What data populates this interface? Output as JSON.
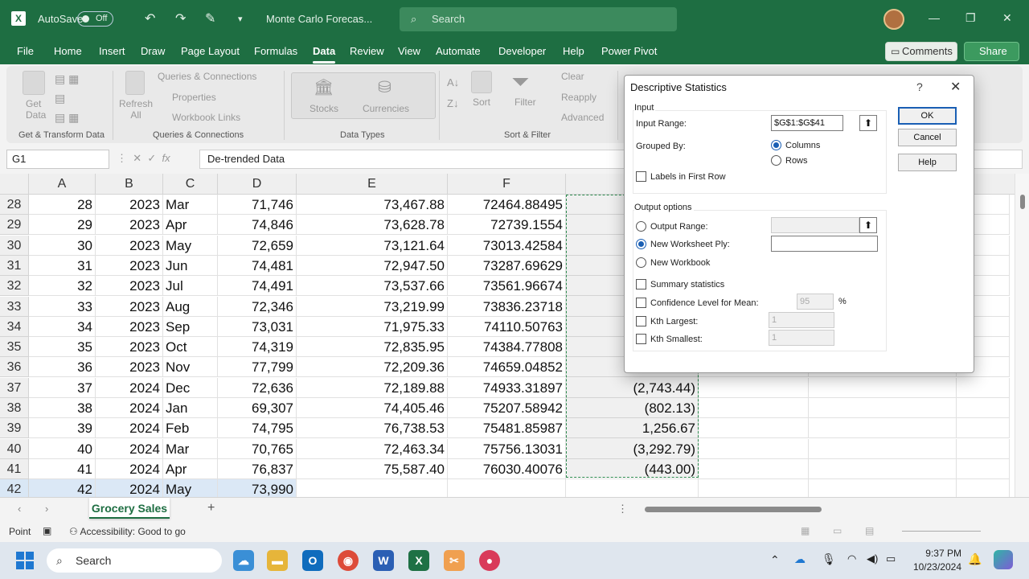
{
  "app": {
    "logo_letter": "X",
    "autosave_label": "AutoSave",
    "autosave_state": "Off",
    "doc_title": "Monte Carlo Forecas...",
    "search_placeholder": "Search"
  },
  "menu": {
    "tabs": [
      "File",
      "Home",
      "Insert",
      "Draw",
      "Page Layout",
      "Formulas",
      "Data",
      "Review",
      "View",
      "Automate",
      "Developer",
      "Help",
      "Power Pivot"
    ],
    "active_tab": "Data",
    "comments_label": "Comments",
    "share_label": "Share"
  },
  "ribbon": {
    "get_data": "Get\nData",
    "refresh_all": "Refresh\nAll",
    "queries_connections": "Queries & Connections",
    "properties": "Properties",
    "workbook_links": "Workbook Links",
    "stocks": "Stocks",
    "currencies": "Currencies",
    "sort": "Sort",
    "filter": "Filter",
    "clear": "Clear",
    "reapply": "Reapply",
    "advanced": "Advanced",
    "groups": {
      "get_transform": "Get & Transform Data",
      "queries": "Queries & Connections",
      "data_types": "Data Types",
      "sort_filter": "Sort & Filter"
    }
  },
  "formula_bar": {
    "name_box": "G1",
    "content": "De-trended Data"
  },
  "grid": {
    "columns": [
      "A",
      "B",
      "C",
      "D",
      "E",
      "F"
    ],
    "rows": [
      {
        "n": "28",
        "a": "28",
        "b": "2023",
        "c": "Mar",
        "d": "71,746",
        "e": "73,467.88",
        "f": "72464.88495",
        "g": ""
      },
      {
        "n": "29",
        "a": "29",
        "b": "2023",
        "c": "Apr",
        "d": "74,846",
        "e": "73,628.78",
        "f": "72739.1554",
        "g": ""
      },
      {
        "n": "30",
        "a": "30",
        "b": "2023",
        "c": "May",
        "d": "72,659",
        "e": "73,121.64",
        "f": "73013.42584",
        "g": ""
      },
      {
        "n": "31",
        "a": "31",
        "b": "2023",
        "c": "Jun",
        "d": "74,481",
        "e": "72,947.50",
        "f": "73287.69629",
        "g": ""
      },
      {
        "n": "32",
        "a": "32",
        "b": "2023",
        "c": "Jul",
        "d": "74,491",
        "e": "73,537.66",
        "f": "73561.96674",
        "g": ""
      },
      {
        "n": "33",
        "a": "33",
        "b": "2023",
        "c": "Aug",
        "d": "72,346",
        "e": "73,219.99",
        "f": "73836.23718",
        "g": ""
      },
      {
        "n": "34",
        "a": "34",
        "b": "2023",
        "c": "Sep",
        "d": "73,031",
        "e": "71,975.33",
        "f": "74110.50763",
        "g": ""
      },
      {
        "n": "35",
        "a": "35",
        "b": "2023",
        "c": "Oct",
        "d": "74,319",
        "e": "72,835.95",
        "f": "74384.77808",
        "g": ""
      },
      {
        "n": "36",
        "a": "36",
        "b": "2023",
        "c": "Nov",
        "d": "77,799",
        "e": "72,209.36",
        "f": "74659.04852",
        "g": ""
      },
      {
        "n": "37",
        "a": "37",
        "b": "2024",
        "c": "Dec",
        "d": "72,636",
        "e": "72,189.88",
        "f": "74933.31897",
        "g": "(2,743.44)"
      },
      {
        "n": "38",
        "a": "38",
        "b": "2024",
        "c": "Jan",
        "d": "69,307",
        "e": "74,405.46",
        "f": "75207.58942",
        "g": "(802.13)"
      },
      {
        "n": "39",
        "a": "39",
        "b": "2024",
        "c": "Feb",
        "d": "74,795",
        "e": "76,738.53",
        "f": "75481.85987",
        "g": "1,256.67"
      },
      {
        "n": "40",
        "a": "40",
        "b": "2024",
        "c": "Mar",
        "d": "70,765",
        "e": "72,463.34",
        "f": "75756.13031",
        "g": "(3,292.79)"
      },
      {
        "n": "41",
        "a": "41",
        "b": "2024",
        "c": "Apr",
        "d": "76,837",
        "e": "75,587.40",
        "f": "76030.40076",
        "g": "(443.00)"
      },
      {
        "n": "42",
        "a": "42",
        "b": "2024",
        "c": "May",
        "d": "73,990",
        "e": "",
        "f": "",
        "g": ""
      }
    ]
  },
  "sheet": {
    "tab": "Grocery Sales",
    "add": "+"
  },
  "status": {
    "mode": "Point",
    "accessibility": "Accessibility: Good to go"
  },
  "dialog": {
    "title": "Descriptive Statistics",
    "help_glyph": "?",
    "close_glyph": "✕",
    "input_section": "Input",
    "input_range_label": "Input Range:",
    "input_range_value": "$G$1:$G$41",
    "grouped_by_label": "Grouped By:",
    "columns_label": "Columns",
    "rows_label": "Rows",
    "labels_first_row": "Labels in First Row",
    "output_section": "Output options",
    "output_range_label": "Output Range:",
    "new_ply_label": "New Worksheet Ply:",
    "new_workbook_label": "New Workbook",
    "summary_stats": "Summary statistics",
    "confidence_label": "Confidence Level for Mean:",
    "confidence_value": "95",
    "percent": "%",
    "kth_largest_label": "Kth Largest:",
    "kth_largest_value": "1",
    "kth_smallest_label": "Kth Smallest:",
    "kth_smallest_value": "1",
    "ok": "OK",
    "cancel": "Cancel",
    "help": "Help"
  },
  "taskbar": {
    "search": "Search",
    "time": "9:37 PM",
    "date": "10/23/2024"
  }
}
